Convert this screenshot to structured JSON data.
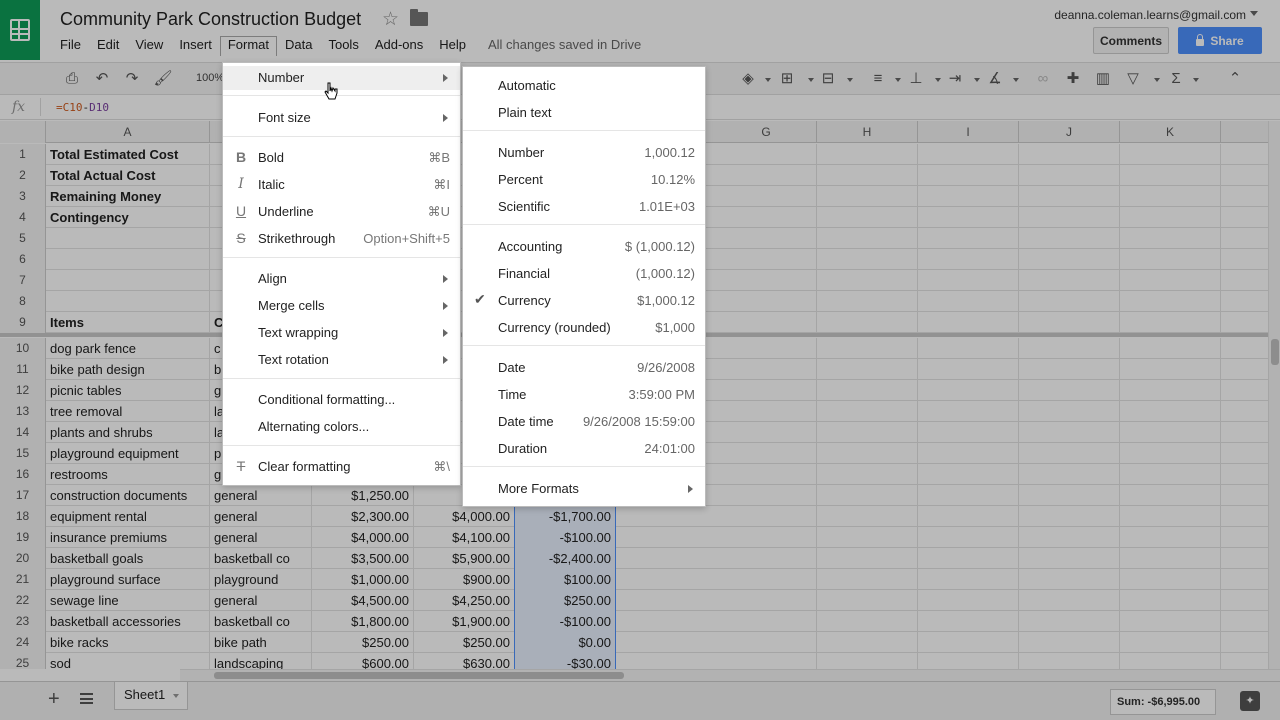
{
  "header": {
    "title": "Community Park Construction Budget",
    "save_status": "All changes saved in Drive",
    "account": "deanna.coleman.learns@gmail.com",
    "comments_label": "Comments",
    "share_label": "Share",
    "menu": [
      "File",
      "Edit",
      "View",
      "Insert",
      "Format",
      "Data",
      "Tools",
      "Add-ons",
      "Help"
    ]
  },
  "toolbar": {
    "zoom": "100%"
  },
  "formula": {
    "fx": "fx",
    "ref1": "=C10",
    "op": "-",
    "ref2": "D10"
  },
  "columns": [
    "A",
    "G",
    "H",
    "I",
    "J",
    "K"
  ],
  "rows": [
    {
      "n": "1",
      "a": "Total Estimated Cost",
      "bold": true
    },
    {
      "n": "2",
      "a": "Total Actual Cost",
      "bold": true
    },
    {
      "n": "3",
      "a": "Remaining Money",
      "bold": true
    },
    {
      "n": "4",
      "a": "Contingency",
      "bold": true
    },
    {
      "n": "5",
      "a": ""
    },
    {
      "n": "6",
      "a": ""
    },
    {
      "n": "7",
      "a": ""
    },
    {
      "n": "8",
      "a": ""
    },
    {
      "n": "9",
      "a": "Items",
      "b": "C",
      "bold": true
    },
    {
      "n": "10",
      "a": "dog park fence",
      "b": "c"
    },
    {
      "n": "11",
      "a": "bike path design",
      "b": "b"
    },
    {
      "n": "12",
      "a": "picnic tables",
      "b": "g"
    },
    {
      "n": "13",
      "a": "tree removal",
      "b": "la"
    },
    {
      "n": "14",
      "a": "plants and shrubs",
      "b": "la"
    },
    {
      "n": "15",
      "a": "playground equipment",
      "b": "p"
    },
    {
      "n": "16",
      "a": "restrooms",
      "b": "g"
    },
    {
      "n": "17",
      "a": "construction documents",
      "b": "general",
      "c": "$1,250.00",
      "d": "$",
      "e": "",
      "dd": true
    },
    {
      "n": "18",
      "a": "equipment rental",
      "b": "general",
      "c": "$2,300.00",
      "d": "$4,000.00",
      "e": "-$1,700.00",
      "dd": true
    },
    {
      "n": "19",
      "a": "insurance premiums",
      "b": "general",
      "c": "$4,000.00",
      "d": "$4,100.00",
      "e": "-$100.00",
      "dd": true
    },
    {
      "n": "20",
      "a": "basketball goals",
      "b": "basketball co",
      "c": "$3,500.00",
      "d": "$5,900.00",
      "e": "-$2,400.00",
      "dd": true
    },
    {
      "n": "21",
      "a": "playground surface",
      "b": "playground",
      "c": "$1,000.00",
      "d": "$900.00",
      "e": "$100.00",
      "dd": true
    },
    {
      "n": "22",
      "a": "sewage line",
      "b": "general",
      "c": "$4,500.00",
      "d": "$4,250.00",
      "e": "$250.00",
      "dd": true
    },
    {
      "n": "23",
      "a": "basketball accessories",
      "b": "basketball co",
      "c": "$1,800.00",
      "d": "$1,900.00",
      "e": "-$100.00",
      "dd": true
    },
    {
      "n": "24",
      "a": "bike racks",
      "b": "bike path",
      "c": "$250.00",
      "d": "$250.00",
      "e": "$0.00",
      "dd": true
    },
    {
      "n": "25",
      "a": "sod",
      "b": "landscaping",
      "c": "$600.00",
      "d": "$630.00",
      "e": "-$30.00",
      "dd": true
    }
  ],
  "format_menu": {
    "number": "Number",
    "font_size": "Font size",
    "bold": "Bold",
    "bold_sc": "⌘B",
    "italic": "Italic",
    "italic_sc": "⌘I",
    "underline": "Underline",
    "underline_sc": "⌘U",
    "strike": "Strikethrough",
    "strike_sc": "Option+Shift+5",
    "align": "Align",
    "merge": "Merge cells",
    "wrap": "Text wrapping",
    "rotation": "Text rotation",
    "conditional": "Conditional formatting...",
    "alternating": "Alternating colors...",
    "clear": "Clear formatting",
    "clear_sc": "⌘\\"
  },
  "number_menu": {
    "automatic": "Automatic",
    "plain": "Plain text",
    "number": "Number",
    "number_ex": "1,000.12",
    "percent": "Percent",
    "percent_ex": "10.12%",
    "scientific": "Scientific",
    "scientific_ex": "1.01E+03",
    "accounting": "Accounting",
    "accounting_ex": "$ (1,000.12)",
    "financial": "Financial",
    "financial_ex": "(1,000.12)",
    "currency": "Currency",
    "currency_ex": "$1,000.12",
    "currency_r": "Currency (rounded)",
    "currency_r_ex": "$1,000",
    "date": "Date",
    "date_ex": "9/26/2008",
    "time": "Time",
    "time_ex": "3:59:00 PM",
    "datetime": "Date time",
    "datetime_ex": "9/26/2008 15:59:00",
    "duration": "Duration",
    "duration_ex": "24:01:00",
    "more": "More Formats"
  },
  "sheetbar": {
    "sheet_name": "Sheet1",
    "sum": "Sum: -$6,995.00"
  }
}
